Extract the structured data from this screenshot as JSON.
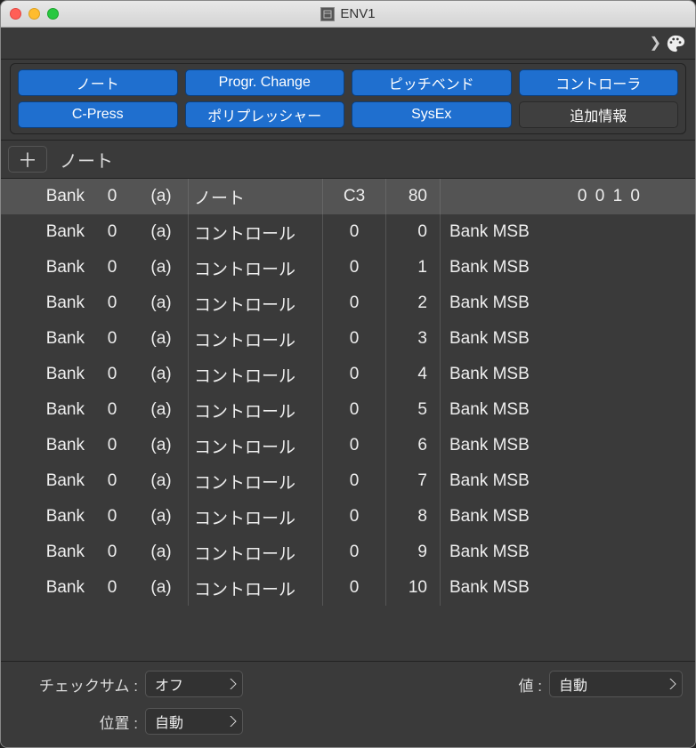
{
  "window": {
    "title": "ENV1"
  },
  "filters": {
    "row1": [
      {
        "label": "ノート",
        "active": true
      },
      {
        "label": "Progr. Change",
        "active": true
      },
      {
        "label": "ピッチベンド",
        "active": true
      },
      {
        "label": "コントローラ",
        "active": true
      }
    ],
    "row2": [
      {
        "label": "C-Press",
        "active": true
      },
      {
        "label": "ポリプレッシャー",
        "active": true
      },
      {
        "label": "SysEx",
        "active": true
      },
      {
        "label": "追加情報",
        "active": false
      }
    ]
  },
  "subheader": {
    "label": "ノート"
  },
  "header_row": {
    "bank": "Bank",
    "ch": "0",
    "ann": "(a)",
    "type": "ノート",
    "v1": "C3",
    "v2": "80",
    "pos": "0 0 1    0"
  },
  "rows": [
    {
      "bank": "Bank",
      "ch": "0",
      "ann": "(a)",
      "type": "コントロール",
      "v1": "0",
      "v2": "0",
      "desc": "Bank MSB"
    },
    {
      "bank": "Bank",
      "ch": "0",
      "ann": "(a)",
      "type": "コントロール",
      "v1": "0",
      "v2": "1",
      "desc": "Bank MSB"
    },
    {
      "bank": "Bank",
      "ch": "0",
      "ann": "(a)",
      "type": "コントロール",
      "v1": "0",
      "v2": "2",
      "desc": "Bank MSB"
    },
    {
      "bank": "Bank",
      "ch": "0",
      "ann": "(a)",
      "type": "コントロール",
      "v1": "0",
      "v2": "3",
      "desc": "Bank MSB"
    },
    {
      "bank": "Bank",
      "ch": "0",
      "ann": "(a)",
      "type": "コントロール",
      "v1": "0",
      "v2": "4",
      "desc": "Bank MSB"
    },
    {
      "bank": "Bank",
      "ch": "0",
      "ann": "(a)",
      "type": "コントロール",
      "v1": "0",
      "v2": "5",
      "desc": "Bank MSB"
    },
    {
      "bank": "Bank",
      "ch": "0",
      "ann": "(a)",
      "type": "コントロール",
      "v1": "0",
      "v2": "6",
      "desc": "Bank MSB"
    },
    {
      "bank": "Bank",
      "ch": "0",
      "ann": "(a)",
      "type": "コントロール",
      "v1": "0",
      "v2": "7",
      "desc": "Bank MSB"
    },
    {
      "bank": "Bank",
      "ch": "0",
      "ann": "(a)",
      "type": "コントロール",
      "v1": "0",
      "v2": "8",
      "desc": "Bank MSB"
    },
    {
      "bank": "Bank",
      "ch": "0",
      "ann": "(a)",
      "type": "コントロール",
      "v1": "0",
      "v2": "9",
      "desc": "Bank MSB"
    },
    {
      "bank": "Bank",
      "ch": "0",
      "ann": "(a)",
      "type": "コントロール",
      "v1": "0",
      "v2": "10",
      "desc": "Bank MSB"
    }
  ],
  "bottom": {
    "checksum_label": "チェックサム :",
    "checksum_value": "オフ",
    "position_label": "位置 :",
    "position_value": "自動",
    "value_label": "値 :",
    "value_value": "自動"
  }
}
